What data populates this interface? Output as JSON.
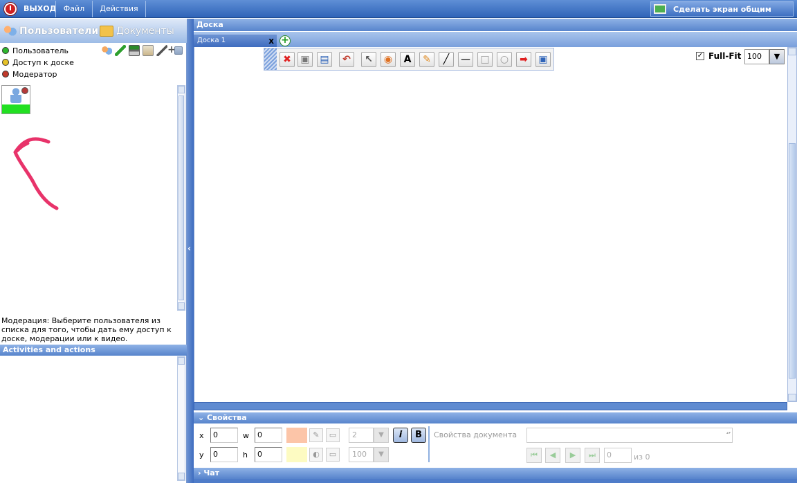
{
  "topbar": {
    "exit_label": "ВЫХОД",
    "file_label": "Файл",
    "actions_label": "Действия",
    "share_label": "Сделать экран общим"
  },
  "left": {
    "tab_users": "Пользователи",
    "tab_documents": "Документы",
    "legend": [
      {
        "label": "Пользователь",
        "color": "#2eb82e"
      },
      {
        "label": "Доступ к доске",
        "color": "#e6c229"
      },
      {
        "label": "Модератор",
        "color": "#c0392b"
      }
    ],
    "moderation_text": "Модерация: Выберите пользователя из списка для того, чтобы дать ему доступ к доске, модерации или к видео.",
    "activities_header": "Activities and actions"
  },
  "board": {
    "header": "Доска",
    "tab_label": "Доска 1",
    "close_glyph": "x",
    "add_glyph": "+",
    "fullfit_label": "Full-Fit",
    "fullfit_checked": true,
    "zoom_value": "100",
    "zoom_glyph": "▼",
    "tools": [
      {
        "icon": "delete-icon",
        "glyph": "✖",
        "color": "#e02020"
      },
      {
        "icon": "new-document-icon",
        "glyph": "▣",
        "color": "#777777"
      },
      {
        "icon": "save-icon",
        "glyph": "▤",
        "color": "#2f64b8"
      },
      {
        "icon": "undo-icon",
        "glyph": "↶",
        "color": "#c0392b"
      },
      {
        "icon": "pointer-icon",
        "glyph": "↖",
        "color": "#555555"
      },
      {
        "icon": "pointer-circle-icon",
        "glyph": "◉",
        "color": "#e07020"
      },
      {
        "icon": "text-icon",
        "glyph": "A",
        "color": "#000000"
      },
      {
        "icon": "pencil-icon",
        "glyph": "✎",
        "color": "#e08a20"
      },
      {
        "icon": "line-icon",
        "glyph": "╱",
        "color": "#000000"
      },
      {
        "icon": "underline-icon",
        "glyph": "—",
        "color": "#555555"
      },
      {
        "icon": "rectangle-icon",
        "glyph": "□",
        "color": "#999999"
      },
      {
        "icon": "ellipse-icon",
        "glyph": "○",
        "color": "#999999"
      },
      {
        "icon": "arrow-icon",
        "glyph": "➡",
        "color": "#e02020"
      },
      {
        "icon": "select-area-icon",
        "glyph": "▣",
        "color": "#2f64b8"
      }
    ]
  },
  "props": {
    "header": "Свойства",
    "x_label": "x",
    "y_label": "y",
    "w_label": "w",
    "h_label": "h",
    "x_value": "0",
    "y_value": "0",
    "w_value": "0",
    "h_value": "0",
    "line_width": "2",
    "opacity": "100",
    "italic_label": "i",
    "bold_label": "B",
    "doc_props_label": "Свойства документа",
    "page_value": "0",
    "page_of": "из 0",
    "stroke_color": "#fcc5a8",
    "fill_color": "#fdfbc2"
  },
  "chat": {
    "header": "Чат"
  }
}
